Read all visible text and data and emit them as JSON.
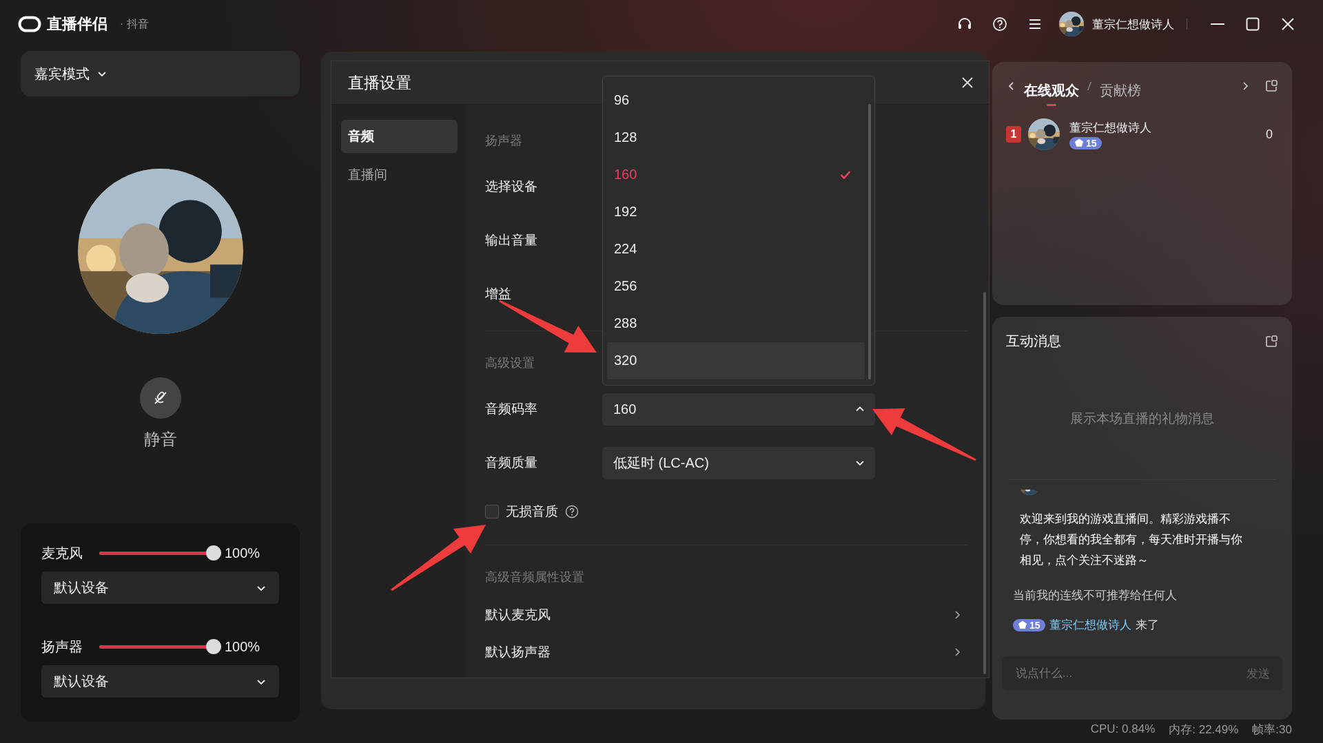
{
  "app": {
    "title": "直播伴侣",
    "platform": "· 抖音",
    "user_name": "董宗仁想做诗人"
  },
  "left_panel": {
    "mode_button": "嘉宾模式",
    "mute_label": "静音",
    "audio_controls": [
      {
        "label": "麦克风",
        "level": 1.0,
        "reading": "100%",
        "device": "默认设备"
      },
      {
        "label": "扬声器",
        "level": 1.0,
        "reading": "100%",
        "device": "默认设备"
      }
    ]
  },
  "dialog": {
    "title": "直播设置",
    "nav": [
      {
        "label": "音频",
        "selected": true
      },
      {
        "label": "直播间",
        "selected": false
      }
    ],
    "rows": [
      {
        "kind": "heading",
        "label": "扬声器"
      },
      {
        "kind": "field",
        "label": "选择设备"
      },
      {
        "kind": "field",
        "label": "输出音量"
      },
      {
        "kind": "field",
        "label": "增益"
      },
      {
        "kind": "heading",
        "label": "高级设置"
      },
      {
        "kind": "select",
        "label": "音频码率",
        "value": "160",
        "expanded": true,
        "options": [
          {
            "label": "96",
            "selected": false,
            "highlighted": false
          },
          {
            "label": "128",
            "selected": false,
            "highlighted": false
          },
          {
            "label": "160",
            "selected": true,
            "highlighted": false
          },
          {
            "label": "192",
            "selected": false,
            "highlighted": false
          },
          {
            "label": "224",
            "selected": false,
            "highlighted": false
          },
          {
            "label": "256",
            "selected": false,
            "highlighted": false
          },
          {
            "label": "288",
            "selected": false,
            "highlighted": false
          },
          {
            "label": "320",
            "selected": false,
            "highlighted": true
          }
        ]
      },
      {
        "kind": "select",
        "label": "音频质量",
        "value": "低延时 (LC-AC)",
        "expanded": false
      },
      {
        "kind": "checkbox",
        "label": "无损音质",
        "checked": false
      },
      {
        "kind": "heading",
        "label": "高级音频属性设置"
      },
      {
        "kind": "link",
        "label": "默认麦克风"
      },
      {
        "kind": "link",
        "label": "默认扬声器"
      }
    ]
  },
  "viewers": {
    "tabs": [
      {
        "label": "在线观众",
        "selected": true
      },
      {
        "label": "贡献榜",
        "selected": false
      }
    ],
    "list": [
      {
        "rank": "1",
        "name": "董宗仁想做诗人",
        "badge": "15",
        "score": "0"
      }
    ]
  },
  "messages": {
    "title": "互动消息",
    "empty_text": "展示本场直播的礼物消息",
    "chat": [
      {
        "kind": "announcement",
        "text": "欢迎来到我的游戏直播间。精彩游戏播不停，你想看的我全都有，每天准时开播与你相见，点个关注不迷路～"
      },
      {
        "kind": "notice",
        "text": "当前我的连线不可推荐给任何人"
      },
      {
        "kind": "join",
        "badge": "15",
        "user": "董宗仁想做诗人",
        "text": "来了"
      }
    ],
    "input": {
      "placeholder": "说点什么...",
      "send": "发送"
    }
  },
  "status_bar": [
    "CPU: 0.84%",
    "内存: 22.49%",
    "帧率:30"
  ]
}
